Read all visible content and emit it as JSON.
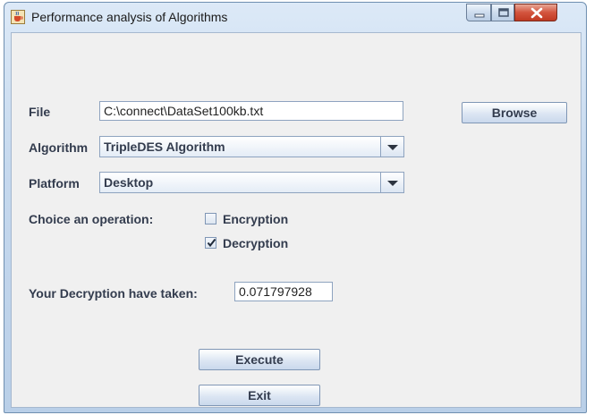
{
  "window": {
    "title": "Performance analysis of Algorithms"
  },
  "form": {
    "file_label": "File",
    "file_value": "C:\\connect\\DataSet100kb.txt",
    "browse_label": "Browse",
    "algorithm_label": "Algorithm",
    "algorithm_selected": "TripleDES Algorithm",
    "platform_label": "Platform",
    "platform_selected": "Desktop",
    "operation_label": "Choice an operation:",
    "encryption_label": "Encryption",
    "encryption_checked": false,
    "decryption_label": "Decryption",
    "decryption_checked": true,
    "result_label": "Your Decryption have taken:",
    "result_value": "0.071797928"
  },
  "buttons": {
    "execute_label": "Execute",
    "exit_label": "Exit"
  },
  "icons": {
    "app": "java-cup-icon",
    "minimize": "minimize-icon",
    "maximize": "maximize-icon",
    "close": "close-icon",
    "dropdown": "chevron-down-icon",
    "check": "check-icon"
  },
  "colors": {
    "title_bar": "#c6d9ee",
    "close_button": "#d3543d",
    "label_text": "#333c4e"
  }
}
